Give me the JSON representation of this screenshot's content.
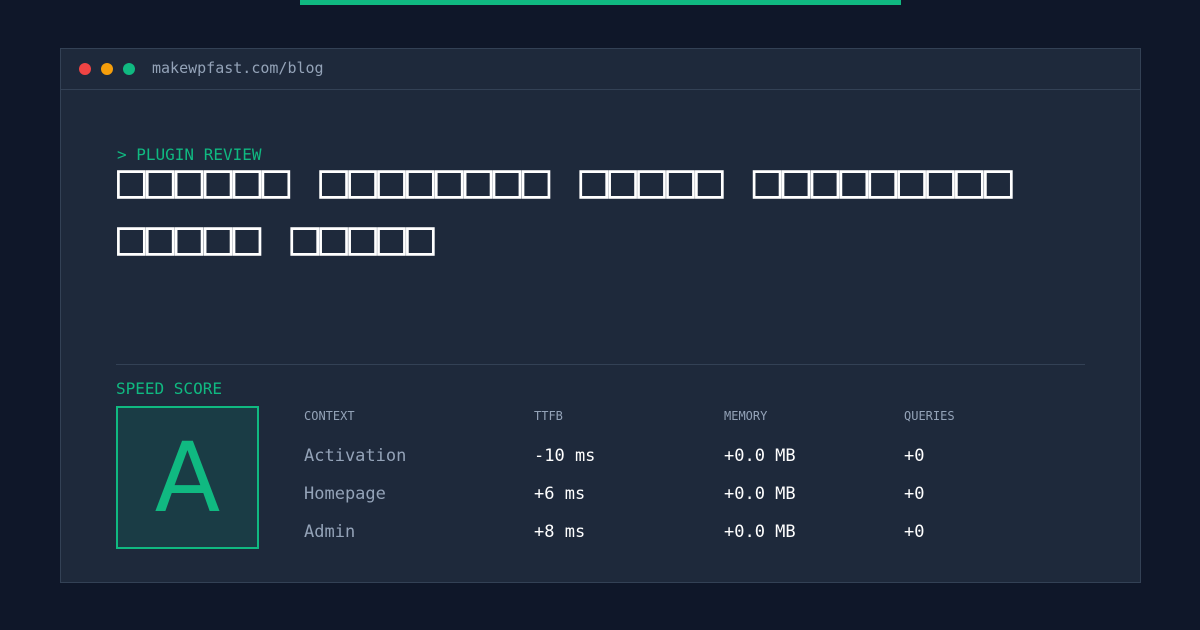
{
  "window": {
    "url": "makewpfast.com/blog"
  },
  "hero": {
    "eyebrow": "> PLUGIN REVIEW",
    "title": "□□□□□□ □□□□□□□□ □□□□□ □□□□□□□□□ □□□□□ □□□□□"
  },
  "score": {
    "label": "SPEED SCORE",
    "grade": "A"
  },
  "metrics": {
    "headers": [
      "CONTEXT",
      "TTFB",
      "MEMORY",
      "QUERIES"
    ],
    "rows": [
      {
        "context": "Activation",
        "ttfb": "-10 ms",
        "memory": "+0.0 MB",
        "queries": "+0"
      },
      {
        "context": "Homepage",
        "ttfb": "+6 ms",
        "memory": "+0.0 MB",
        "queries": "+0"
      },
      {
        "context": "Admin",
        "ttfb": "+8 ms",
        "memory": "+0.0 MB",
        "queries": "+0"
      }
    ]
  },
  "colors": {
    "accent": "#10b981",
    "background": "#0f1729",
    "panel": "#1e293b",
    "muted": "#94a3b8"
  }
}
